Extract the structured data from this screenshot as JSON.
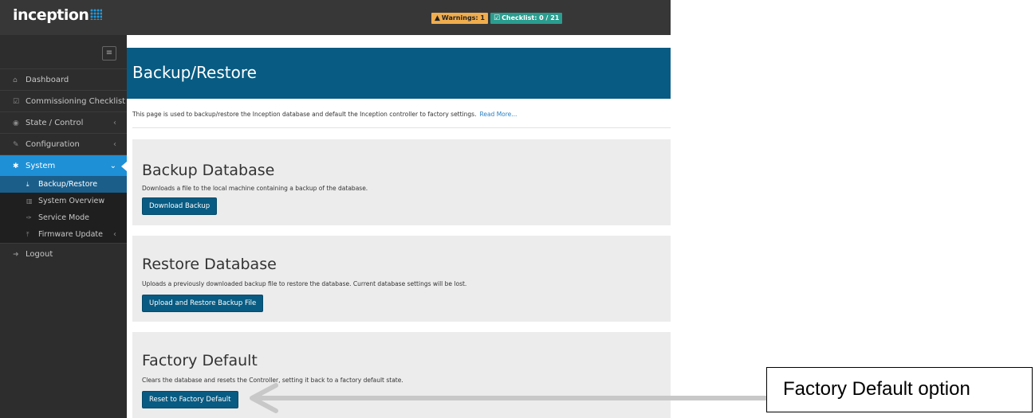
{
  "topbar": {
    "logo_text": "inception",
    "warnings_label": "Warnings: 1",
    "checklist_label": "Checklist: 0 / 21"
  },
  "sidebar": {
    "items": [
      {
        "label": "Dashboard",
        "icon": "home-icon"
      },
      {
        "label": "Commissioning Checklist",
        "icon": "checklist-icon"
      },
      {
        "label": "State / Control",
        "icon": "eye-icon"
      },
      {
        "label": "Configuration",
        "icon": "edit-icon"
      },
      {
        "label": "System",
        "icon": "gear-icon"
      }
    ],
    "subitems": [
      {
        "label": "Backup/Restore",
        "icon": "download-icon"
      },
      {
        "label": "System Overview",
        "icon": "bar-chart-icon"
      },
      {
        "label": "Service Mode",
        "icon": "wrench-icon"
      },
      {
        "label": "Firmware Update",
        "icon": "upload-icon"
      }
    ],
    "logout_label": "Logout"
  },
  "page": {
    "title": "Backup/Restore",
    "intro": "This page is used to backup/restore the Inception database and default the Inception controller to factory settings.",
    "read_more": "Read More..."
  },
  "panels": {
    "backup": {
      "title": "Backup Database",
      "description": "Downloads a file to the local machine containing a backup of the database.",
      "button": "Download Backup"
    },
    "restore": {
      "title": "Restore Database",
      "description": "Uploads a previously downloaded backup file to restore the database. Current database settings will be lost.",
      "button": "Upload and Restore Backup File"
    },
    "factory": {
      "title": "Factory Default",
      "description": "Clears the database and resets the Controller, setting it back to a factory default state.",
      "button": "Reset to Factory Default"
    }
  },
  "annotation": {
    "label": "Factory Default option",
    "arrow_color": "#c8c8c8"
  },
  "colors": {
    "header_blue": "#085b82",
    "active_blue": "#1e90d6",
    "warning": "#f0ad4e",
    "checklist": "#2a9d8f"
  }
}
